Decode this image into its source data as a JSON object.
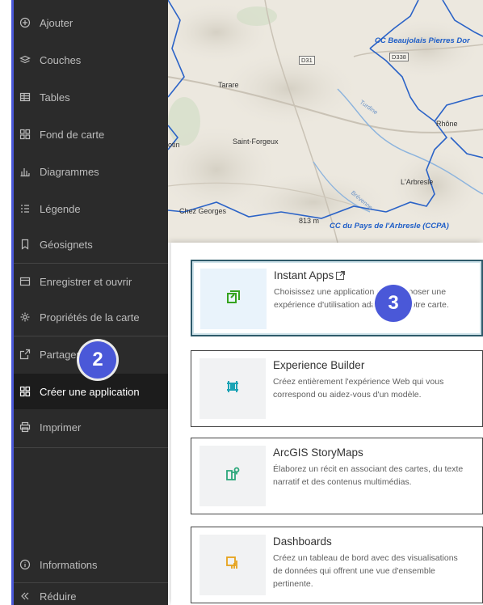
{
  "sidebar": {
    "items": [
      {
        "label": "Ajouter",
        "icon": "plus-circle-icon"
      },
      {
        "label": "Couches",
        "icon": "layers-icon"
      },
      {
        "label": "Tables",
        "icon": "table-icon"
      },
      {
        "label": "Fond de carte",
        "icon": "basemap-icon"
      },
      {
        "label": "Diagrammes",
        "icon": "chart-icon"
      },
      {
        "label": "Légende",
        "icon": "legend-icon"
      },
      {
        "label": "Géosignets",
        "icon": "bookmark-icon"
      },
      {
        "label": "Enregistrer et ouvrir",
        "icon": "save-icon"
      },
      {
        "label": "Propriétés de la carte",
        "icon": "gear-icon"
      },
      {
        "label": "Partager la carte",
        "icon": "share-icon"
      },
      {
        "label": "Créer une application",
        "icon": "apps-grid-icon"
      },
      {
        "label": "Imprimer",
        "icon": "print-icon"
      }
    ],
    "footer": [
      {
        "label": "Informations",
        "icon": "info-icon"
      },
      {
        "label": "Réduire",
        "icon": "collapse-icon"
      }
    ]
  },
  "map": {
    "labels": {
      "tarare": "Tarare",
      "saint_forgeux": "Saint-Forgeux",
      "rhone": "Rhône",
      "larbresle": "L'Arbresle",
      "chez_georges": "Chez Georges",
      "altitude": "813 m",
      "otin": "otin",
      "cc_beaujolais": "CC Beaujolais Pierres Dor",
      "cc_arbresle": "CC du Pays de l'Arbresle (CCPA)",
      "road_d31": "D31",
      "road_d338": "D338",
      "turdine": "Turdine",
      "brevenne": "Brévenne"
    }
  },
  "cards": [
    {
      "title": "Instant Apps",
      "description": "Choisissez une application pour proposer une expérience d'utilisation adaptée de votre carte.",
      "icon": "instant-apps-icon",
      "color": "#35a31f"
    },
    {
      "title": "Experience Builder",
      "description": "Créez entièrement l'expérience Web qui vous correspond ou aidez-vous d'un modèle.",
      "icon": "experience-builder-icon",
      "color": "#1aa3b5"
    },
    {
      "title": "ArcGIS StoryMaps",
      "description": "Élaborez un récit en associant des cartes, du texte narratif et des contenus multimédias.",
      "icon": "storymaps-icon",
      "color": "#2ba77a"
    },
    {
      "title": "Dashboards",
      "description": "Créez un tableau de bord avec des visualisations de données qui offrent une vue d'ensemble pertinente.",
      "icon": "dashboards-icon",
      "color": "#e6a21a"
    }
  ],
  "badges": {
    "step2": "2",
    "step3": "3"
  },
  "colors": {
    "sidebar_bg": "#2b2b2b",
    "accent": "#4a58d8",
    "selected_border": "#2e5a6a"
  }
}
